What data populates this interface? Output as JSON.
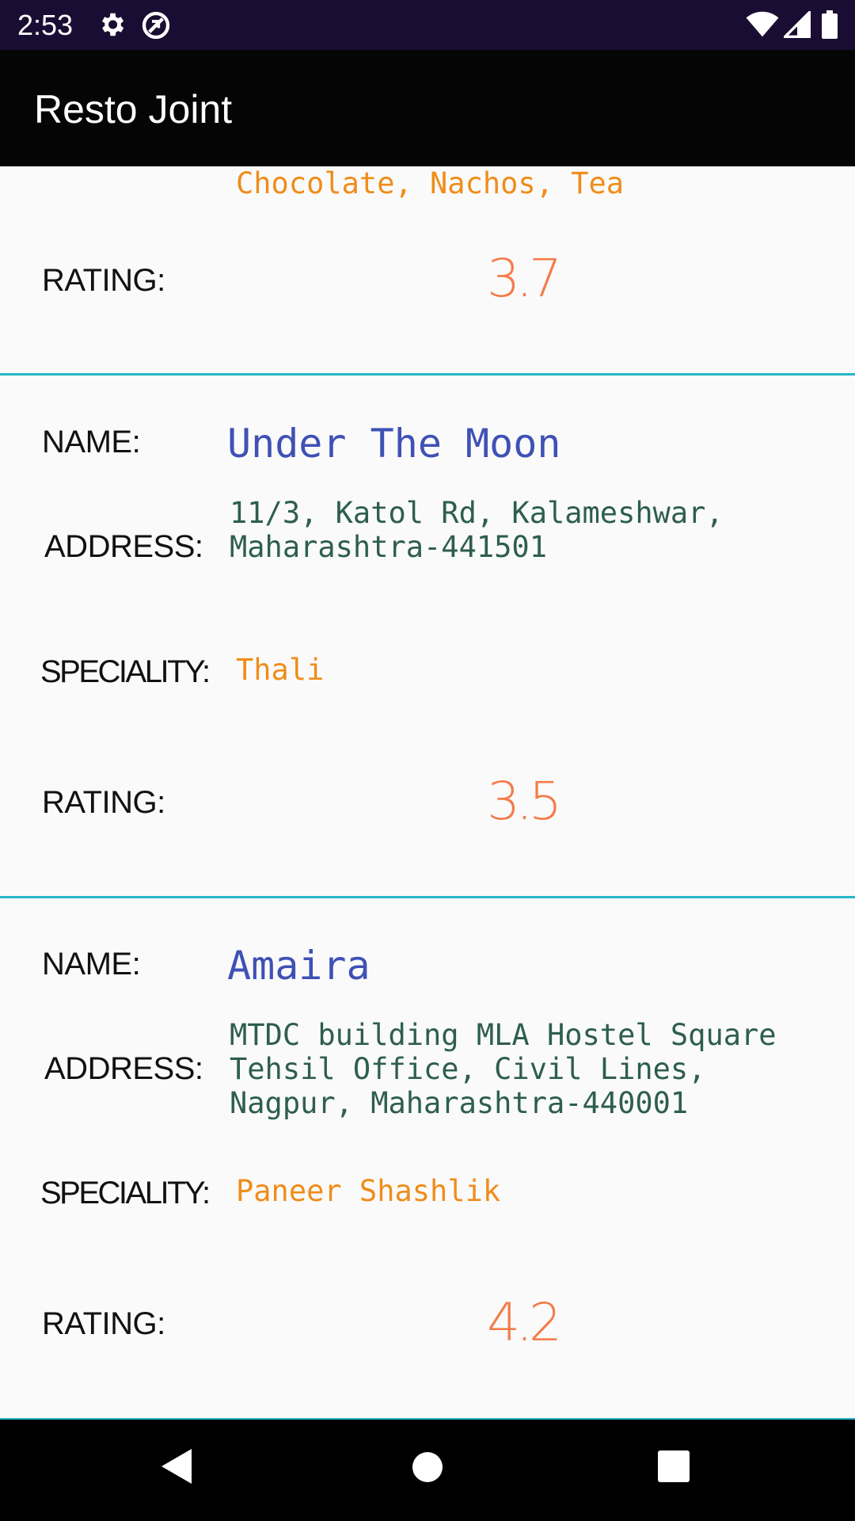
{
  "status_bar": {
    "time": "2:53",
    "icons": [
      "gear-icon",
      "sync-off-icon",
      "wifi-icon",
      "signal-icon",
      "battery-icon"
    ]
  },
  "app_bar": {
    "title": "Resto Joint"
  },
  "restaurants": [
    {
      "speciality": "Chocolate, Nachos, Tea",
      "rating": "3.7"
    },
    {
      "name": "Under The Moon",
      "address": "11/3, Katol Rd, Kalameshwar,\nMaharashtra-441501",
      "speciality": "Thali",
      "rating": "3.5"
    },
    {
      "name": "Amaira",
      "address": "MTDC building MLA Hostel Square\nTehsil Office, Civil Lines,\nNagpur, Maharashtra-440001",
      "speciality": "Paneer Shashlik",
      "rating": "4.2"
    }
  ],
  "labels": {
    "name": "NAME:",
    "address": "ADDRESS:",
    "speciality": "SPECIALITY:",
    "rating": "RATING:"
  },
  "colors": {
    "status_bar": "#1a0d33",
    "app_bar": "#050505",
    "divider": "#26b7c9",
    "name": "#3f51b5",
    "address": "#2e5e4e",
    "speciality": "#f08c1a",
    "rating": "#f47c4a"
  },
  "nav_bar": {
    "icons": [
      "back-icon",
      "home-icon",
      "recents-icon"
    ]
  }
}
